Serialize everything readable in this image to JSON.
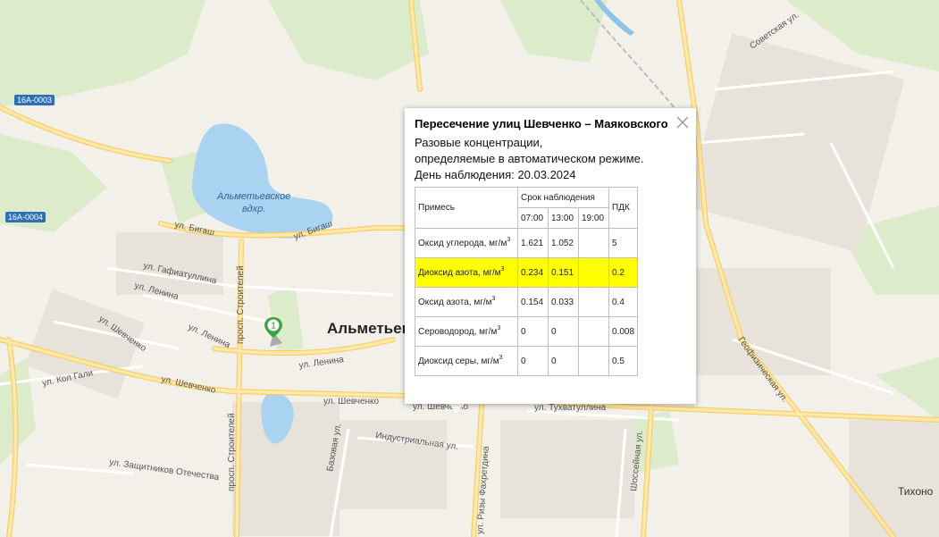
{
  "map": {
    "city": "Альметьевск",
    "reservoir": [
      "Альметьевское",
      "вдхр."
    ],
    "shields": [
      "16А-0003",
      "16А-0004"
    ],
    "streets": [
      "ул. Бигаш",
      "ул. Бигаш",
      "ул. Гафиатуллина",
      "ул. Ленина",
      "ул. Ленина",
      "ул. Ленина",
      "ул. Шевченко",
      "ул. Шевченко",
      "ул. Шевченко",
      "ул. Шевченко",
      "ул. Кол Гали",
      "просп. Строителей",
      "просп. Строителей",
      "ул. Защитников Отечества",
      "Индустриальная ул.",
      "Базовая ул.",
      "ул. Ризы Фахретдина",
      "ул. Тухватуллина",
      "Шоссейная ул.",
      "Геофизическая ул.",
      "Советская ул.",
      "Тихоно"
    ],
    "marker_label": "1"
  },
  "popup": {
    "title": "Пересечение улиц Шевченко – Маяковского",
    "line1": "Разовые концентрации,",
    "line2": "определяемые в автоматическом режиме.",
    "line3": "День наблюдения: 20.03.2024",
    "table": {
      "col_substance": "Примесь",
      "col_period": "Срок наблюдения",
      "col_pdk": "ПДК",
      "times": [
        "07:00",
        "13:00",
        "19:00"
      ],
      "unit_prefix": "мг/м",
      "unit_exp": "3",
      "rows": [
        {
          "name": "Оксид углерода,",
          "v1": "1.621",
          "v2": "1.052",
          "v3": "",
          "pdk": "5"
        },
        {
          "name": "Диоксид азота,",
          "v1": "0.234",
          "v2": "0.151",
          "v3": "",
          "pdk": "0.2"
        },
        {
          "name": "Оксид азота,",
          "v1": "0.154",
          "v2": "0.033",
          "v3": "",
          "pdk": "0.4"
        },
        {
          "name": "Сероводород,",
          "v1": "0",
          "v2": "0",
          "v3": "",
          "pdk": "0.008"
        },
        {
          "name": "Диоксид серы,",
          "v1": "0",
          "v2": "0",
          "v3": "",
          "pdk": "0.5"
        }
      ]
    }
  },
  "colors": {
    "highlight": "#ffff00",
    "marker": "#3aa53a",
    "water": "#a9d3f0",
    "main_road": "#ffe9a8",
    "shield": "#2f6fb5"
  }
}
